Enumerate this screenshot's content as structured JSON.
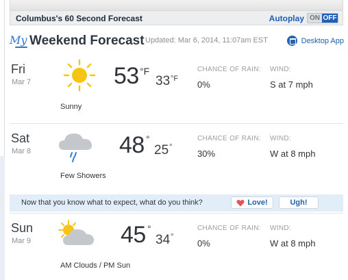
{
  "video_bar": {
    "title": "Columbus's 60 Second Forecast",
    "autoplay_label": "Autoplay",
    "toggle_on": "ON",
    "toggle_off": "OFF"
  },
  "header": {
    "logo": "My",
    "title": "Weekend Forecast",
    "updated": "Updated: Mar 6, 2014, 11:07am EST",
    "desktop_app": "Desktop App",
    "desktop_icon": "desktop-app-icon"
  },
  "labels": {
    "chance_of_rain": "CHANCE OF RAIN:",
    "wind": "WIND:"
  },
  "days": [
    {
      "day": "Fri",
      "date": "Mar 7",
      "high": "53",
      "high_unit": "°F",
      "low": "33",
      "low_unit": "°F",
      "rain": "0%",
      "wind": "S at 7 mph",
      "condition": "Sunny",
      "icon": "sunny-icon"
    },
    {
      "day": "Sat",
      "date": "Mar 8",
      "high": "48",
      "high_unit": "°",
      "low": "25",
      "low_unit": "°",
      "rain": "30%",
      "wind": "W at 8 mph",
      "condition": "Few Showers",
      "icon": "showers-icon"
    },
    {
      "day": "Sun",
      "date": "Mar 9",
      "high": "45",
      "high_unit": "°",
      "low": "34",
      "low_unit": "°",
      "rain": "0%",
      "wind": "W at 8 mph",
      "condition": "AM Clouds / PM Sun",
      "icon": "partly-cloudy-icon"
    }
  ],
  "feedback": {
    "question": "Now that you know what to expect, what do you think?",
    "love": "Love!",
    "ugh": "Ugh!"
  },
  "colors": {
    "accent_blue": "#1f5fb5",
    "sun_yellow": "#f6c514",
    "cloud_gray": "#c4c8cc",
    "feedback_bg": "#e1eef9"
  }
}
